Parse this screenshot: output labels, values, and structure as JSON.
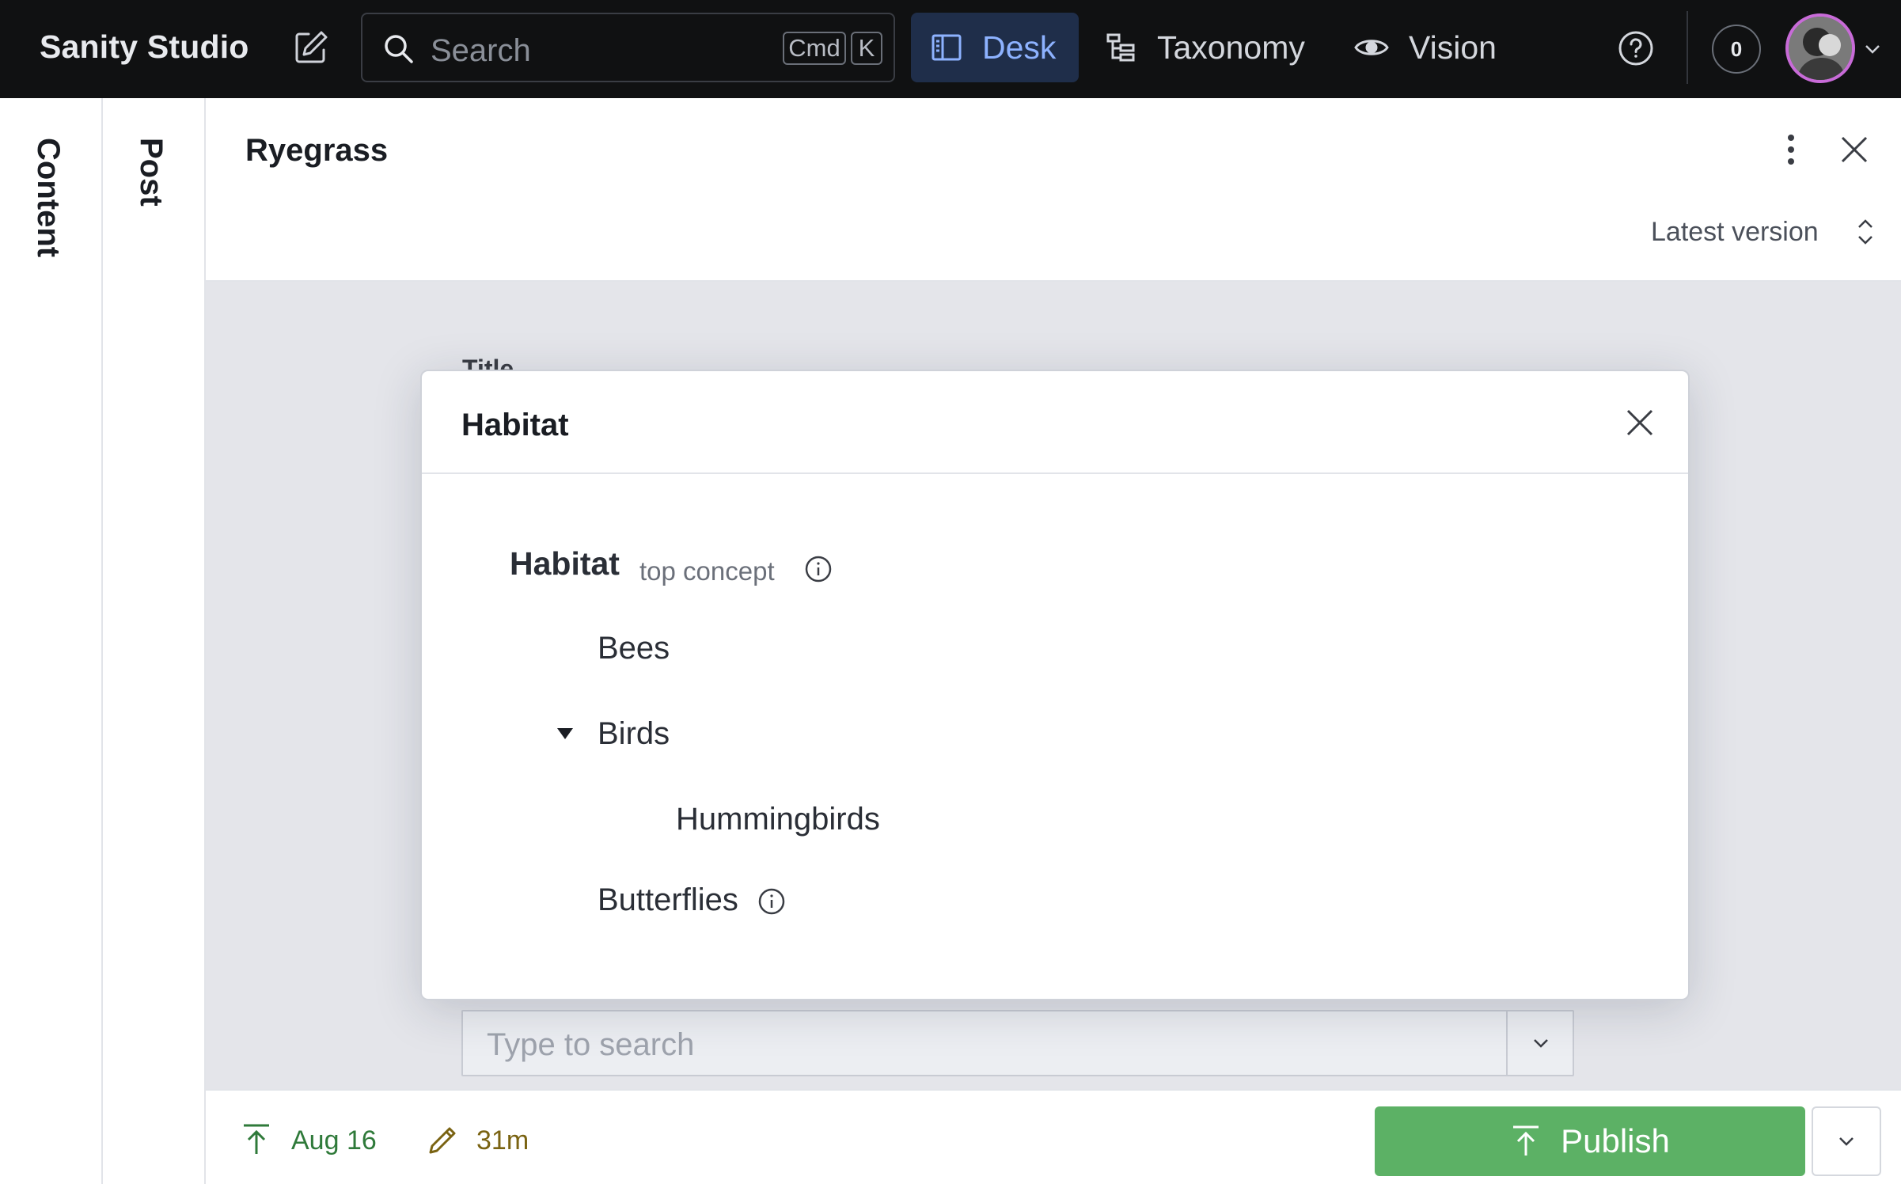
{
  "app": {
    "title": "Sanity Studio"
  },
  "search": {
    "placeholder": "Search",
    "shortcut_cmd": "Cmd",
    "shortcut_key": "K"
  },
  "nav": {
    "tabs": [
      {
        "label": "Desk",
        "icon": "desk-icon",
        "active": true
      },
      {
        "label": "Taxonomy",
        "icon": "tree-icon",
        "active": false
      },
      {
        "label": "Vision",
        "icon": "eye-icon",
        "active": false
      }
    ],
    "notification_count": "0"
  },
  "rails": {
    "content": "Content",
    "post": "Post"
  },
  "document": {
    "title": "Ryegrass",
    "version_label": "Latest version",
    "field_title_label": "Title",
    "search_placeholder": "Type to search"
  },
  "footer": {
    "published": "Aug 16",
    "edited": "31m",
    "publish_label": "Publish"
  },
  "dialog": {
    "title": "Habitat",
    "root": {
      "label": "Habitat",
      "tag": "top concept"
    },
    "items": {
      "bees": "Bees",
      "birds": "Birds",
      "hummingbirds": "Hummingbirds",
      "butterflies": "Butterflies"
    }
  },
  "colors": {
    "nav_bg": "#101112",
    "active_tab_bg": "#1f2e4a",
    "active_tab_text": "#8db2ff",
    "publish_green": "#5cb165",
    "avatar_ring": "#c86bd8"
  }
}
